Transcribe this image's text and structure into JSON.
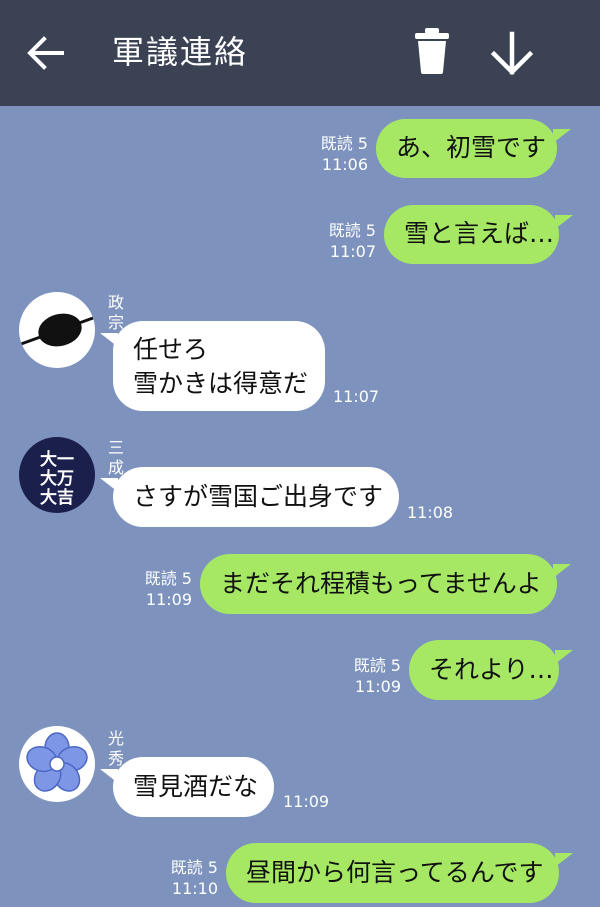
{
  "header": {
    "title": "軍議連絡",
    "back_icon": "arrow-left-icon",
    "trash_icon": "trash-icon",
    "download_icon": "arrow-down-icon"
  },
  "colors": {
    "header_bg": "#3a4254",
    "chat_bg": "#7d93be",
    "sent_bubble": "#a6e864",
    "received_bubble": "#ffffff"
  },
  "messages": [
    {
      "direction": "sent",
      "text": "あ、初雪です",
      "read": "既読 5",
      "time": "11:06"
    },
    {
      "direction": "sent",
      "text": "雪と言えば…",
      "read": "既読 5",
      "time": "11:07"
    },
    {
      "direction": "received",
      "sender": "政宗",
      "avatar": "eyepatch-avatar",
      "lines": [
        "任せろ",
        "雪かきは得意だ"
      ],
      "time": "11:07"
    },
    {
      "direction": "received",
      "sender": "三成",
      "avatar": "crest-avatar",
      "crest_text": "大一大万大吉",
      "text": "さすが雪国ご出身です",
      "time": "11:08"
    },
    {
      "direction": "sent",
      "text": "まだそれ程積もってませんよ",
      "read": "既読 5",
      "time": "11:09"
    },
    {
      "direction": "sent",
      "text": "それより…",
      "read": "既読 5",
      "time": "11:09"
    },
    {
      "direction": "received",
      "sender": "光秀",
      "avatar": "bellflower-avatar",
      "text": "雪見酒だな",
      "time": "11:09"
    },
    {
      "direction": "sent",
      "text": "昼間から何言ってるんです",
      "read": "既読 5",
      "time": "11:10"
    }
  ]
}
